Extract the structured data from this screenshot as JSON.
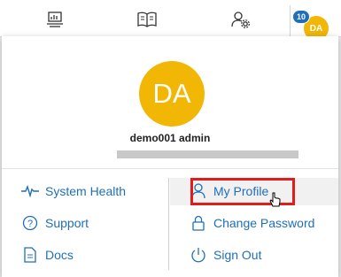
{
  "header": {
    "notification_count": "10",
    "avatar_initials": "DA"
  },
  "profile": {
    "initials": "DA",
    "name": "demo001 admin"
  },
  "menu": {
    "left": [
      {
        "label": "System Health",
        "icon": "pulse-icon"
      },
      {
        "label": "Support",
        "icon": "question-circle-icon"
      },
      {
        "label": "Docs",
        "icon": "document-icon"
      }
    ],
    "right": [
      {
        "label": "My Profile",
        "icon": "user-icon"
      },
      {
        "label": "Change Password",
        "icon": "lock-icon"
      },
      {
        "label": "Sign Out",
        "icon": "power-icon"
      }
    ]
  },
  "colors": {
    "accent": "#1f6fb8",
    "avatar": "#f2b705",
    "highlight": "#e21b1b"
  }
}
